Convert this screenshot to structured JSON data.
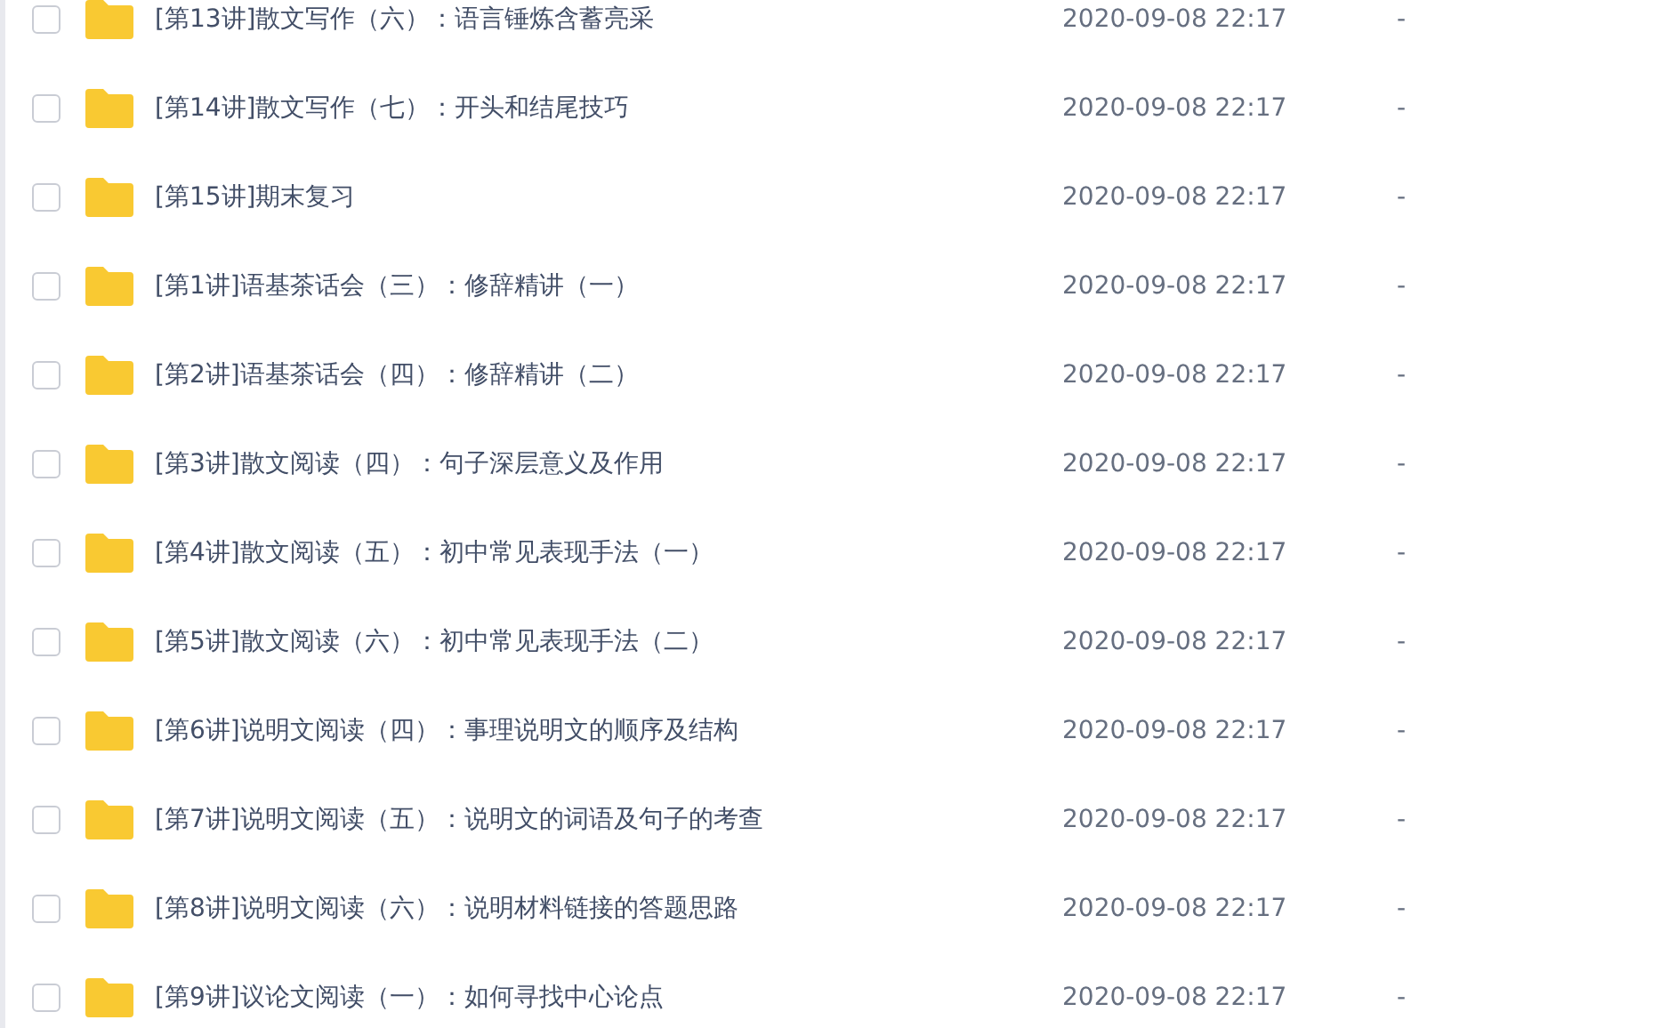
{
  "files": [
    {
      "name": "[第13讲]散文写作（六）：语言锤炼含蓄亮采",
      "modified": "2020-09-08 22:17",
      "size": "-",
      "checked": false
    },
    {
      "name": "[第14讲]散文写作（七）：开头和结尾技巧",
      "modified": "2020-09-08 22:17",
      "size": "-",
      "checked": false
    },
    {
      "name": "[第15讲]期末复习",
      "modified": "2020-09-08 22:17",
      "size": "-",
      "checked": false
    },
    {
      "name": "[第1讲]语基茶话会（三）：修辞精讲（一）",
      "modified": "2020-09-08 22:17",
      "size": "-",
      "checked": false
    },
    {
      "name": "[第2讲]语基茶话会（四）：修辞精讲（二）",
      "modified": "2020-09-08 22:17",
      "size": "-",
      "checked": false
    },
    {
      "name": "[第3讲]散文阅读（四）：句子深层意义及作用",
      "modified": "2020-09-08 22:17",
      "size": "-",
      "checked": false
    },
    {
      "name": "[第4讲]散文阅读（五）：初中常见表现手法（一）",
      "modified": "2020-09-08 22:17",
      "size": "-",
      "checked": false
    },
    {
      "name": "[第5讲]散文阅读（六）：初中常见表现手法（二）",
      "modified": "2020-09-08 22:17",
      "size": "-",
      "checked": false
    },
    {
      "name": "[第6讲]说明文阅读（四）：事理说明文的顺序及结构",
      "modified": "2020-09-08 22:17",
      "size": "-",
      "checked": false
    },
    {
      "name": "[第7讲]说明文阅读（五）：说明文的词语及句子的考查",
      "modified": "2020-09-08 22:17",
      "size": "-",
      "checked": false
    },
    {
      "name": "[第8讲]说明文阅读（六）：说明材料链接的答题思路",
      "modified": "2020-09-08 22:17",
      "size": "-",
      "checked": false
    },
    {
      "name": "[第9讲]议论文阅读（一）：如何寻找中心论点",
      "modified": "2020-09-08 22:17",
      "size": "-",
      "checked": false
    }
  ]
}
